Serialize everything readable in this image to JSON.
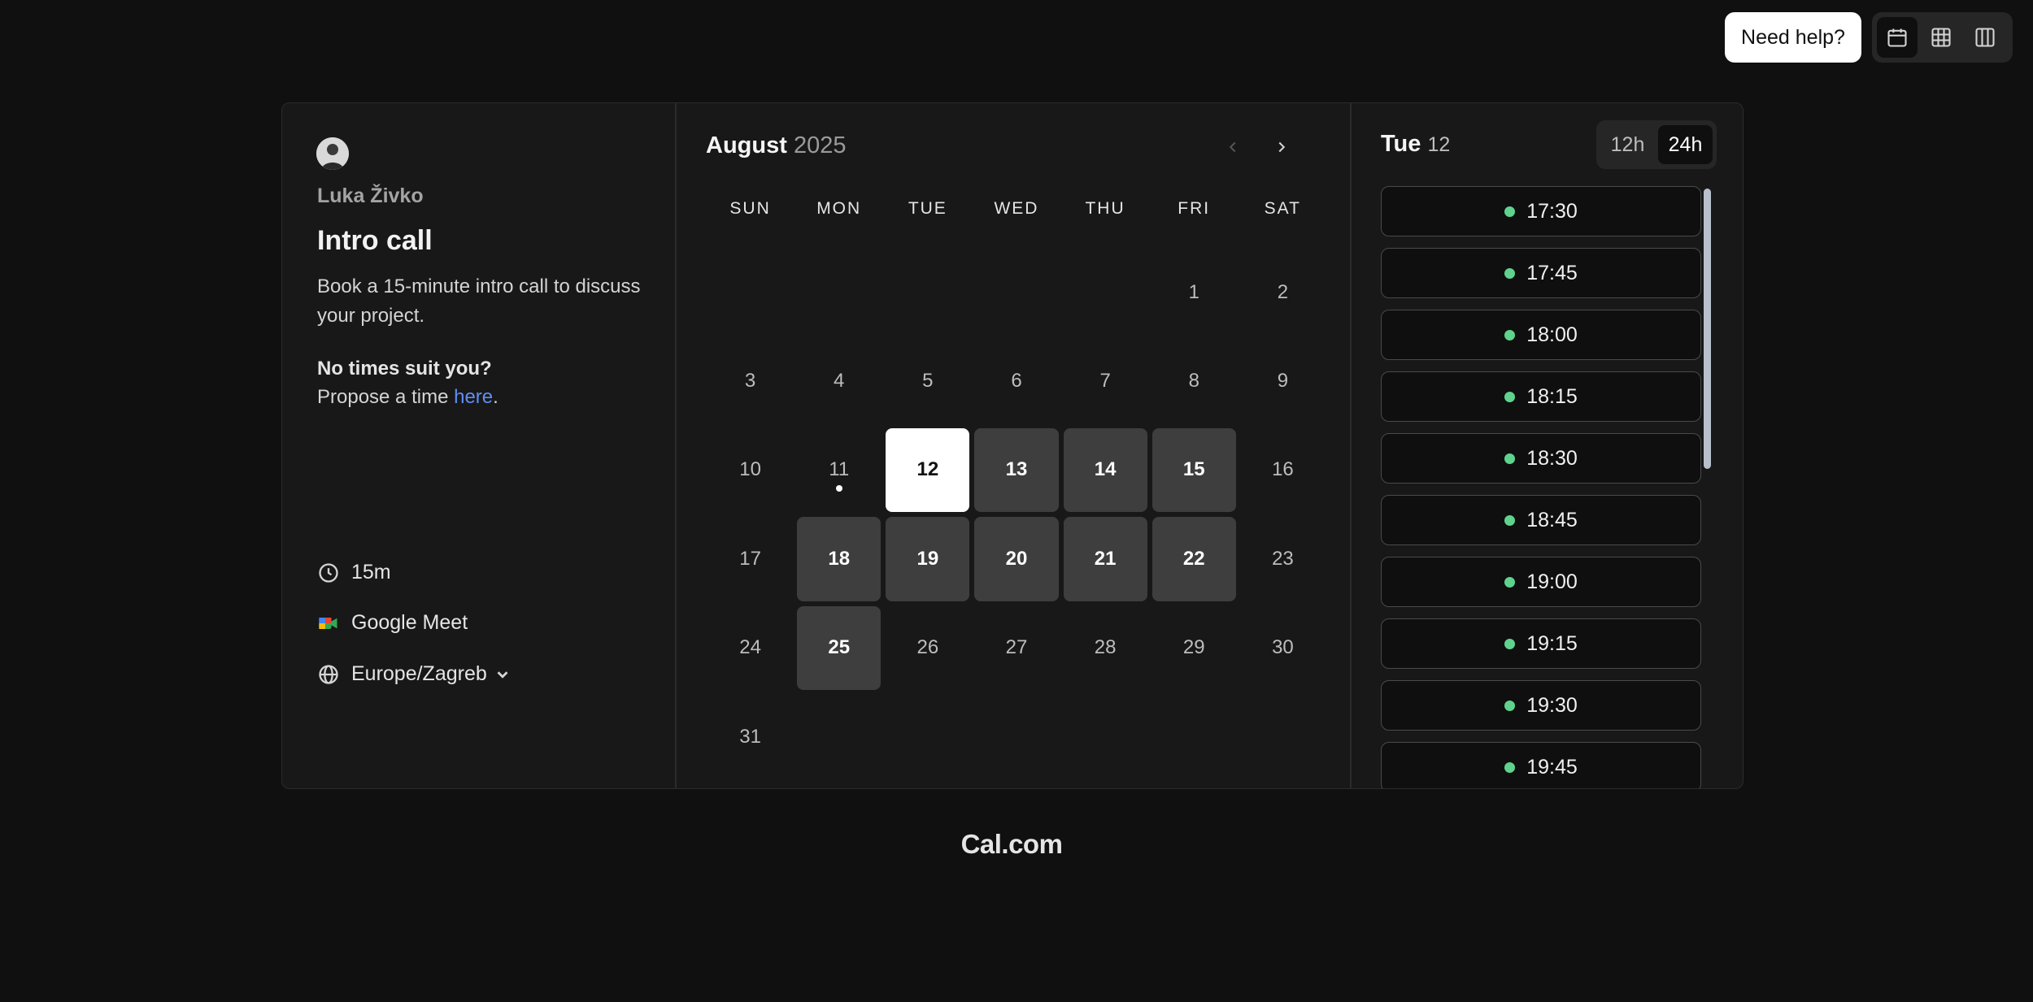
{
  "topbar": {
    "help_label": "Need help?",
    "views": [
      {
        "name": "month-view",
        "icon": "calendar-icon",
        "active": true
      },
      {
        "name": "week-view",
        "icon": "grid-icon",
        "active": false
      },
      {
        "name": "column-view",
        "icon": "columns-icon",
        "active": false
      }
    ]
  },
  "profile": {
    "host_name": "Luka Živko",
    "event_title": "Intro call",
    "description": "Book a 15-minute intro call to discuss your project.",
    "no_times_heading": "No times suit you?",
    "propose_prefix": "Propose a time ",
    "propose_link": "here",
    "propose_suffix": ".",
    "duration": "15m",
    "location": "Google Meet",
    "timezone": "Europe/Zagreb"
  },
  "calendar": {
    "month": "August",
    "year": "2025",
    "weekdays": [
      "SUN",
      "MON",
      "TUE",
      "WED",
      "THU",
      "FRI",
      "SAT"
    ],
    "leading_blanks": 5,
    "days_in_month": 31,
    "available_days": [
      13,
      14,
      15,
      18,
      19,
      20,
      21,
      22,
      25
    ],
    "selected_day": 12,
    "today": 11
  },
  "slots_panel": {
    "day_name": "Tue",
    "day_number": "12",
    "format_12h": "12h",
    "format_24h": "24h",
    "active_format": "24h",
    "slots": [
      "17:30",
      "17:45",
      "18:00",
      "18:15",
      "18:30",
      "18:45",
      "19:00",
      "19:15",
      "19:30",
      "19:45"
    ],
    "available_color": "#5fd38d"
  },
  "footer": {
    "brand": "Cal.com"
  }
}
